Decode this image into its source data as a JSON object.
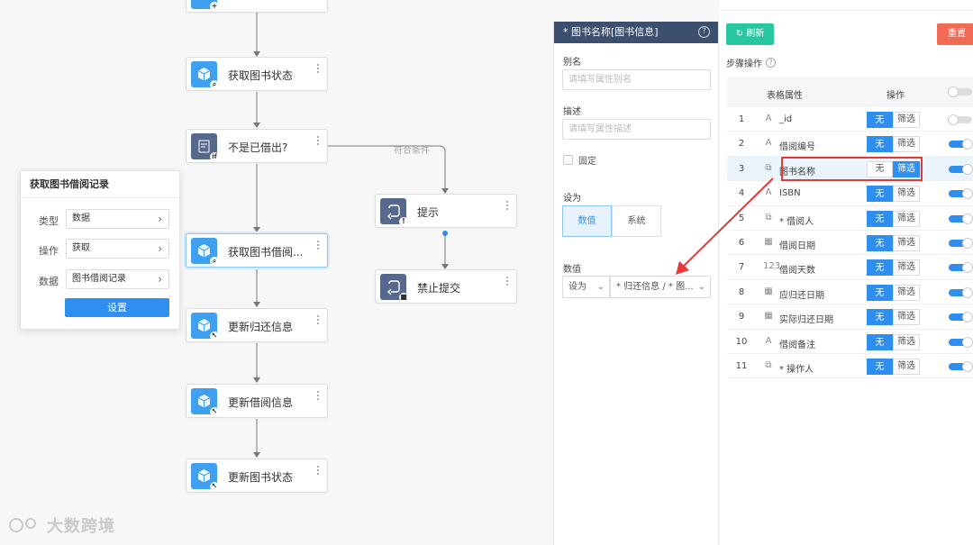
{
  "canvas": {
    "nodes": {
      "top": {
        "label": ""
      },
      "get_status": {
        "label": "获取图书状态"
      },
      "not_borrowed": {
        "label": "不是已借出?"
      },
      "get_borrow": {
        "label": "获取图书借阅..."
      },
      "update_return": {
        "label": "更新归还信息"
      },
      "update_borrow": {
        "label": "更新借阅信息"
      },
      "update_status": {
        "label": "更新图书状态"
      },
      "tip": {
        "label": "提示"
      },
      "stop_submit": {
        "label": "禁止提交"
      }
    },
    "edge_label": "符合条件"
  },
  "popover": {
    "title": "获取图书借阅记录",
    "type_label": "类型",
    "type_value": "数据",
    "op_label": "操作",
    "op_value": "获取",
    "data_label": "数据",
    "data_value": "图书借阅记录",
    "button": "设置"
  },
  "mid": {
    "title": "* 图书名称[图书信息]",
    "help": "?",
    "alias_label": "别名",
    "alias_placeholder": "请填写属性别名",
    "desc_label": "描述",
    "desc_placeholder": "请填写属性描述",
    "fixed_label": "固定",
    "setas_label": "设为",
    "seg_value": "数值",
    "seg_system": "系统",
    "value_label": "数值",
    "value_mode": "设为",
    "value_text": "* 归还信息 / * 图..."
  },
  "right": {
    "refresh": "刷新",
    "reset": "重置",
    "steps_label": "步骤操作",
    "help": "?",
    "col_attr": "表格属性",
    "col_op": "操作",
    "btn_none": "无",
    "btn_filter": "筛选",
    "rows": [
      {
        "num": "1",
        "icon": "A",
        "name": "_id",
        "highlight": false,
        "toggle": false
      },
      {
        "num": "2",
        "icon": "A",
        "name": "借阅编号",
        "highlight": false,
        "toggle": true
      },
      {
        "num": "3",
        "icon": "⧉",
        "name": "图书名称",
        "highlight": true,
        "toggle": true
      },
      {
        "num": "4",
        "icon": "A",
        "name": "ISBN",
        "highlight": false,
        "toggle": true
      },
      {
        "num": "5",
        "icon": "⧉",
        "name": "* 借阅人",
        "highlight": false,
        "toggle": true
      },
      {
        "num": "6",
        "icon": "▦",
        "name": "借阅日期",
        "highlight": false,
        "toggle": true
      },
      {
        "num": "7",
        "icon": "123",
        "name": "借阅天数",
        "highlight": false,
        "toggle": true
      },
      {
        "num": "8",
        "icon": "▦",
        "name": "应归还日期",
        "highlight": false,
        "toggle": true
      },
      {
        "num": "9",
        "icon": "▦",
        "name": "实际归还日期",
        "highlight": false,
        "toggle": true
      },
      {
        "num": "10",
        "icon": "A",
        "name": "借阅备注",
        "highlight": false,
        "toggle": true
      },
      {
        "num": "11",
        "icon": "⧉",
        "name": "* 操作人",
        "highlight": false,
        "toggle": true
      }
    ]
  },
  "watermark": "大数跨境",
  "colors": {
    "primary": "#2e8ff0",
    "refresh": "#28c7a2",
    "reset": "#f16a54",
    "header": "#3d4f6e",
    "highlight": "#e53935"
  }
}
